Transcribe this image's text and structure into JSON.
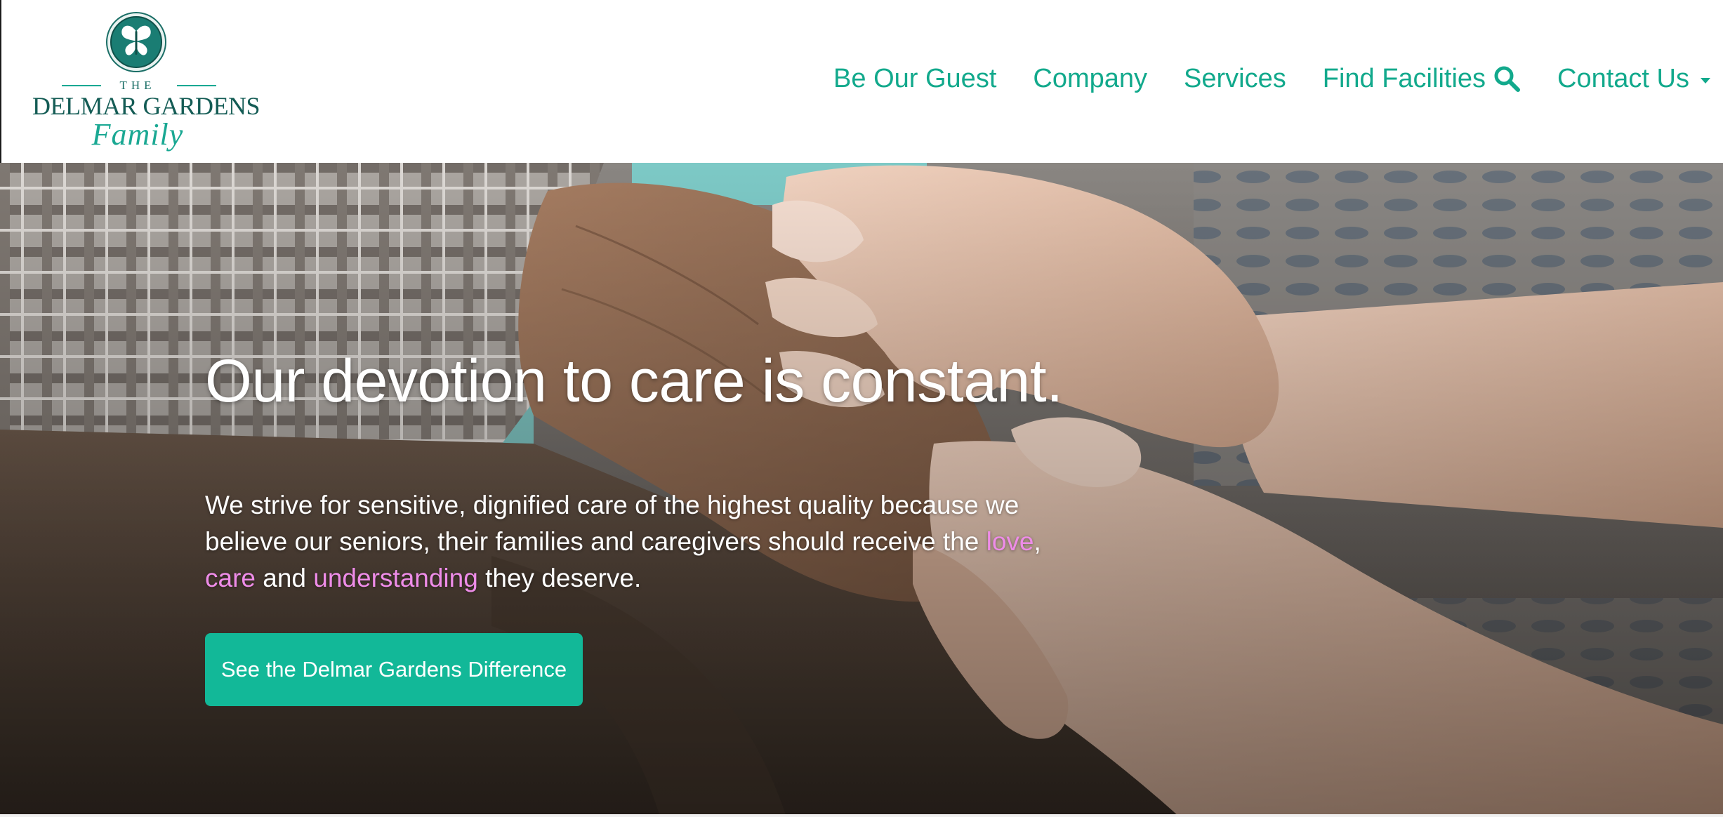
{
  "brand": {
    "logo_the": "THE",
    "logo_name": "DELMAR GARDENS",
    "logo_script": "Family"
  },
  "nav": {
    "items": [
      {
        "label": "Be Our Guest"
      },
      {
        "label": "Company"
      },
      {
        "label": "Services"
      },
      {
        "label": "Find Facilities",
        "icon": "search-icon"
      },
      {
        "label": "Contact Us",
        "icon": "caret-down-icon"
      }
    ]
  },
  "hero": {
    "title": "Our devotion to care is constant.",
    "body_part1": "We strive for sensitive, dignified care of the highest quality because we believe our seniors, their families and caregivers should receive the ",
    "highlight_love": "love",
    "body_part2": ", ",
    "highlight_care": "care",
    "body_part3": " and ",
    "highlight_understanding": "understanding",
    "body_part4": " they deserve.",
    "cta_label": "See the Delmar Gardens Difference"
  },
  "colors": {
    "brand_teal": "#12a98c",
    "cta_teal": "#12b898",
    "highlight_pink": "#ee8ce8",
    "logo_dark_teal": "#145c55"
  }
}
